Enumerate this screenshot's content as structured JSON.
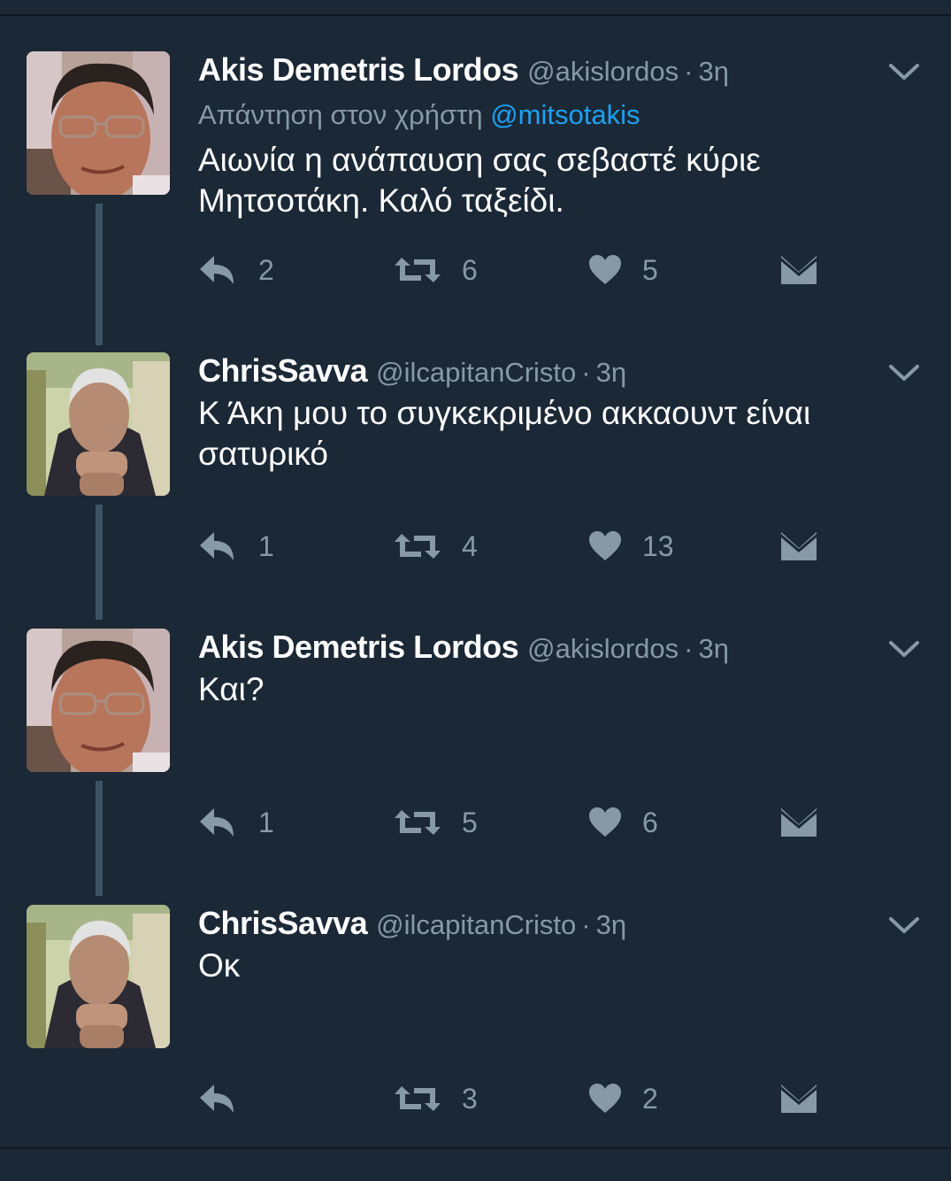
{
  "colors": {
    "background": "#1b2836",
    "separator": "#10171e",
    "thread_line": "#3d5466",
    "primary_text": "#ffffff",
    "secondary_text": "#8899a6",
    "link": "#1da1f2",
    "icon": "#8899a6"
  },
  "icons": {
    "reply": "reply-arrow-icon",
    "retweet": "retweet-icon",
    "like": "heart-icon",
    "dm": "envelope-icon",
    "menu": "chevron-down-icon"
  },
  "tweets": [
    {
      "name": "Akis Demetris Lordos",
      "handle": "@akislordos",
      "dot": "·",
      "time": "3η",
      "reply_prefix": "Απάντηση στον χρήστη ",
      "reply_mention": "@mitsotakis",
      "text": "Αιωνία η ανάπαυση σας σεβαστέ κύριε\nΜητσοτάκη. Καλό ταξείδι.",
      "replies": "2",
      "retweets": "6",
      "likes": "5"
    },
    {
      "name": "ChrisSavva",
      "handle": "@ilcapitanCristo",
      "dot": "·",
      "time": "3η",
      "text": "Κ Άκη μου το συγκεκριμένο ακκαουντ είναι\nσατυρικό",
      "replies": "1",
      "retweets": "4",
      "likes": "13"
    },
    {
      "name": "Akis Demetris Lordos",
      "handle": "@akislordos",
      "dot": "·",
      "time": "3η",
      "text": "Και?",
      "replies": "1",
      "retweets": "5",
      "likes": "6"
    },
    {
      "name": "ChrisSavva",
      "handle": "@ilcapitanCristo",
      "dot": "·",
      "time": "3η",
      "text": "Οκ",
      "replies": "",
      "retweets": "3",
      "likes": "2"
    }
  ]
}
